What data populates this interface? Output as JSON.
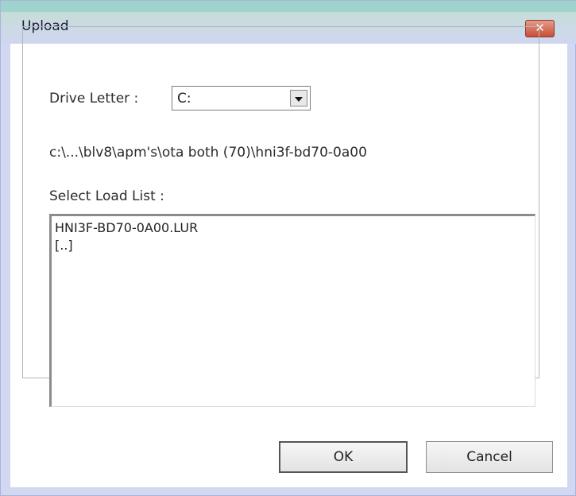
{
  "window": {
    "title": "Upload",
    "close_glyph": "✕"
  },
  "drive": {
    "label": "Drive Letter :",
    "selected": "C:"
  },
  "path": {
    "text": "c:\\...\\blv8\\apm's\\ota both (70)\\hni3f-bd70-0a00"
  },
  "load_list": {
    "label": "Select Load List :",
    "items": [
      "HNI3F-BD70-0A00.LUR",
      "[..]"
    ]
  },
  "buttons": {
    "ok": "OK",
    "cancel": "Cancel"
  },
  "colors": {
    "title_strip": "#9fd3cd",
    "frame": "#d3d8f2",
    "close_button": "#c94f3a"
  },
  "icons": {
    "close": "close-icon",
    "dropdown": "chevron-down-icon"
  }
}
